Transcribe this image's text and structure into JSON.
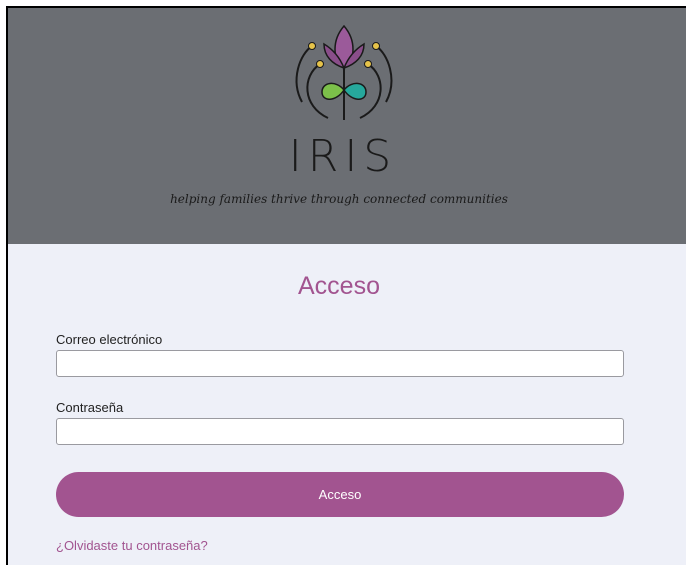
{
  "brand": {
    "name": "IRIS",
    "tagline": "helping families thrive through connected communities"
  },
  "login": {
    "title": "Acceso",
    "email_label": "Correo electrónico",
    "email_value": "",
    "email_placeholder": "",
    "password_label": "Contraseña",
    "password_value": "",
    "password_placeholder": "",
    "submit_label": "Acceso",
    "forgot_link": "¿Olvidaste tu contraseña?"
  },
  "colors": {
    "header_bg": "#6b6e73",
    "page_bg": "#eef0f8",
    "accent": "#a25490",
    "logo_petal": "#9b5a9a",
    "logo_leaf_green": "#7cc04a",
    "logo_leaf_teal": "#26a89c",
    "logo_dot": "#e6c34a"
  },
  "icons": {
    "logo": "iris-flower-logo-icon"
  }
}
